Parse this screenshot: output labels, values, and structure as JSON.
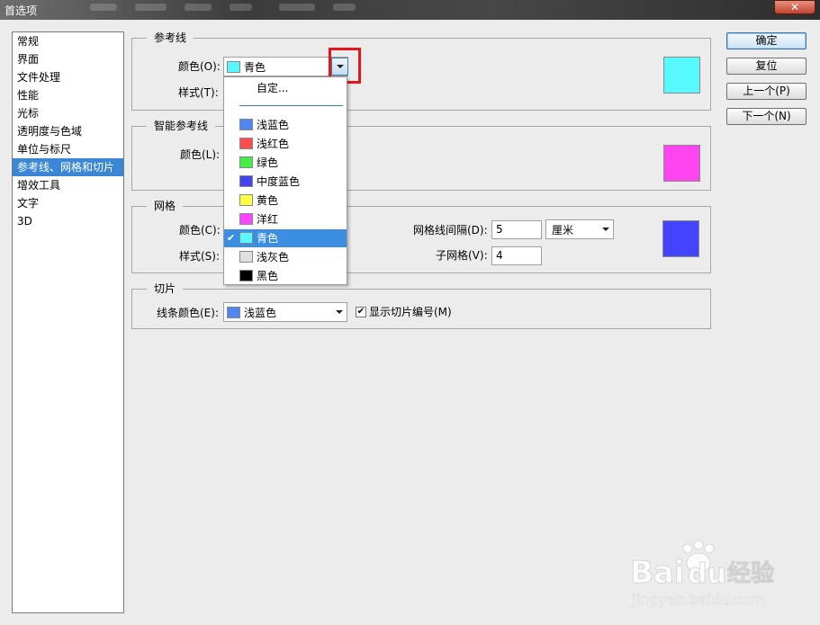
{
  "window": {
    "title": "首选项",
    "close_label": "✕"
  },
  "nav": {
    "items": [
      "常规",
      "界面",
      "文件处理",
      "性能",
      "光标",
      "透明度与色域",
      "单位与标尺",
      "参考线、网格和切片",
      "增效工具",
      "文字",
      "3D"
    ],
    "selected_index": 7
  },
  "guides": {
    "title": "参考线",
    "color_label": "颜色(O):",
    "color_value": "青色",
    "color_hex": "#55f9ff",
    "style_label": "样式(T):"
  },
  "smart_guides": {
    "title": "智能参考线",
    "color_label": "颜色(L):",
    "color_hex": "#ff44f2"
  },
  "grid": {
    "title": "网格",
    "color_label": "颜色(C):",
    "style_label": "样式(S):",
    "spacing_label": "网格线间隔(D):",
    "spacing_value": "5",
    "unit_value": "厘米",
    "subdiv_label": "子网格(V):",
    "subdiv_value": "4",
    "color_hex": "#4444ff"
  },
  "slices": {
    "title": "切片",
    "line_color_label": "线条颜色(E):",
    "line_color_value": "浅蓝色",
    "line_color_hex": "#4f86f0",
    "show_numbers_label": "显示切片编号(M)",
    "show_numbers_checked": true
  },
  "buttons": {
    "ok": "确定",
    "reset": "复位",
    "prev": "上一个(P)",
    "next": "下一个(N)"
  },
  "dropdown": {
    "custom_label": "自定...",
    "options": [
      {
        "label": "浅蓝色",
        "color": "#4f86f0"
      },
      {
        "label": "浅红色",
        "color": "#ff4c4c"
      },
      {
        "label": "绿色",
        "color": "#44ee44"
      },
      {
        "label": "中度蓝色",
        "color": "#4444ee"
      },
      {
        "label": "黄色",
        "color": "#ffff44"
      },
      {
        "label": "洋红",
        "color": "#ff44ff"
      },
      {
        "label": "青色",
        "color": "#55f9ff"
      },
      {
        "label": "浅灰色",
        "color": "#e0e0e0"
      },
      {
        "label": "黑色",
        "color": "#000000"
      }
    ],
    "selected_index": 6
  },
  "watermark": {
    "brand": "Bai",
    "brand_end": "经验",
    "url": "jingyan.baidu.com"
  }
}
